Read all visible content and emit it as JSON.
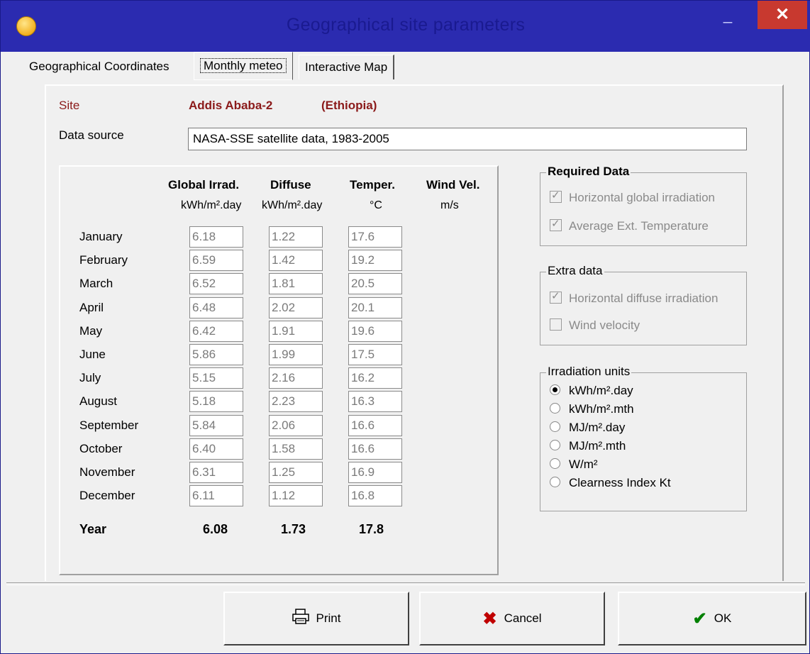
{
  "window": {
    "title": "Geographical site parameters",
    "min_glyph": "_",
    "max_glyph": "□",
    "close_glyph": "✕"
  },
  "tabs": [
    "Geographical Coordinates",
    "Monthly meteo",
    "Interactive Map"
  ],
  "site": {
    "label": "Site",
    "name": "Addis Ababa-2",
    "country": "(Ethiopia)"
  },
  "data_source": {
    "label": "Data source",
    "value": "NASA-SSE satellite data,  1983-2005"
  },
  "table": {
    "headers": [
      "Global Irrad.",
      "Diffuse",
      "Temper.",
      "Wind Vel."
    ],
    "units": [
      "kWh/m².day",
      "kWh/m².day",
      "°C",
      "m/s"
    ],
    "months": [
      "January",
      "February",
      "March",
      "April",
      "May",
      "June",
      "July",
      "August",
      "September",
      "October",
      "November",
      "December"
    ],
    "global": [
      "6.18",
      "6.59",
      "6.52",
      "6.48",
      "6.42",
      "5.86",
      "5.15",
      "5.18",
      "5.84",
      "6.40",
      "6.31",
      "6.11"
    ],
    "diffuse": [
      "1.22",
      "1.42",
      "1.81",
      "2.02",
      "1.91",
      "1.99",
      "2.16",
      "2.23",
      "2.06",
      "1.58",
      "1.25",
      "1.12"
    ],
    "temp": [
      "17.6",
      "19.2",
      "20.5",
      "20.1",
      "19.6",
      "17.5",
      "16.2",
      "16.3",
      "16.6",
      "16.6",
      "16.9",
      "16.8"
    ],
    "year_label": "Year",
    "year_values": [
      "6.08",
      "1.73",
      "17.8"
    ]
  },
  "required_data": {
    "title": "Required Data",
    "items": [
      "Horizontal global irradiation",
      "Average Ext. Temperature"
    ],
    "checked": [
      true,
      true
    ]
  },
  "extra_data": {
    "title": "Extra data",
    "items": [
      "Horizontal diffuse irradiation",
      "Wind velocity"
    ],
    "checked": [
      true,
      false
    ]
  },
  "irradiation_units": {
    "title": "Irradiation units",
    "options": [
      "kWh/m².day",
      "kWh/m².mth",
      "MJ/m².day",
      "MJ/m².mth",
      "W/m²",
      "Clearness Index Kt"
    ],
    "selected": 0
  },
  "buttons": {
    "print": "Print",
    "cancel": "Cancel",
    "ok": "OK"
  }
}
